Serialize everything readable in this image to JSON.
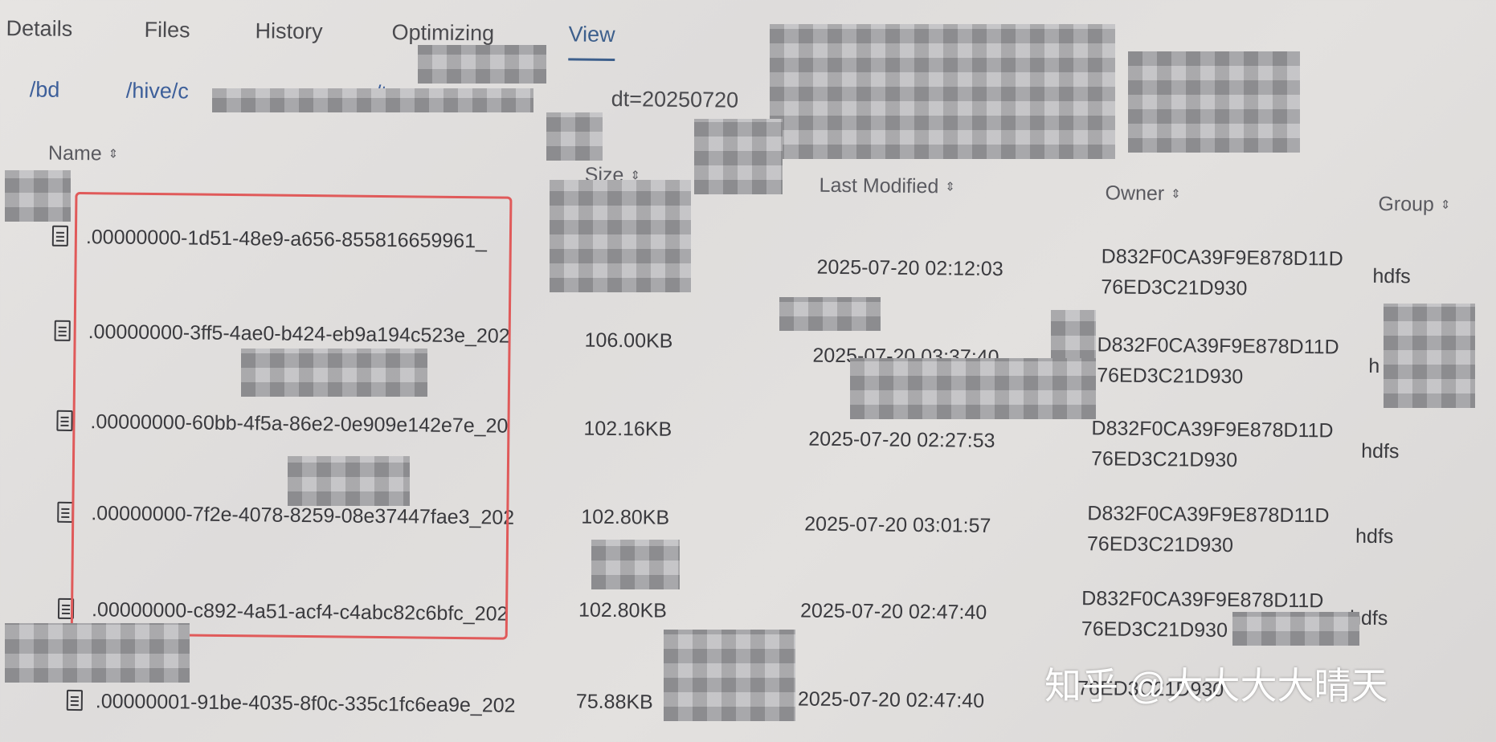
{
  "tabs": [
    {
      "label": "Details"
    },
    {
      "label": "Files"
    },
    {
      "label": "History"
    },
    {
      "label": "Optimizing"
    },
    {
      "label": "View"
    }
  ],
  "breadcrumb": {
    "parts": [
      "/bd",
      "/hive/c",
      "/t"
    ],
    "partition": "dt=20250720"
  },
  "columns": {
    "name": "Name",
    "size": "Size",
    "last_modified": "Last Modified",
    "owner": "Owner",
    "group": "Group"
  },
  "rows": [
    {
      "name": ".00000000-1d51-48e9-a656-855816659961_",
      "size": "",
      "modified": "2025-07-20 02:12:03",
      "owner_line1": "D832F0CA39F9E878D11D",
      "owner_line2": "76ED3C21D930",
      "group": "hdfs"
    },
    {
      "name": ".00000000-3ff5-4ae0-b424-eb9a194c523e_202",
      "size": "106.00KB",
      "modified": "2025-07-20 03:37:40",
      "owner_line1": "D832F0CA39F9E878D11D",
      "owner_line2": "76ED3C21D930",
      "group": "h"
    },
    {
      "name": ".00000000-60bb-4f5a-86e2-0e909e142e7e_20",
      "size": "102.16KB",
      "modified": "2025-07-20 02:27:53",
      "owner_line1": "D832F0CA39F9E878D11D",
      "owner_line2": "76ED3C21D930",
      "group": "hdfs"
    },
    {
      "name": ".00000000-7f2e-4078-8259-08e37447fae3_202",
      "size": "102.80KB",
      "modified": "2025-07-20 03:01:57",
      "owner_line1": "D832F0CA39F9E878D11D",
      "owner_line2": "76ED3C21D930",
      "group": "hdfs"
    },
    {
      "name": ".00000000-c892-4a51-acf4-c4abc82c6bfc_202",
      "size": "102.80KB",
      "modified": "2025-07-20 02:47:40",
      "owner_line1": "D832F0CA39F9E878D11D",
      "owner_line2": "76ED3C21D930",
      "group": "hdfs"
    },
    {
      "name": ".00000001-91be-4035-8f0c-335c1fc6ea9e_202",
      "size": "75.88KB",
      "modified": "2025-07-20 02:47:40",
      "owner_line1": "",
      "owner_line2": "76ED3C21D930",
      "group": ""
    }
  ],
  "watermark": "知乎 @大大大大晴天",
  "colors": {
    "tab_active": "#3d5f8c",
    "highlight_box": "#e05a5a",
    "link": "#3d5f9a"
  }
}
